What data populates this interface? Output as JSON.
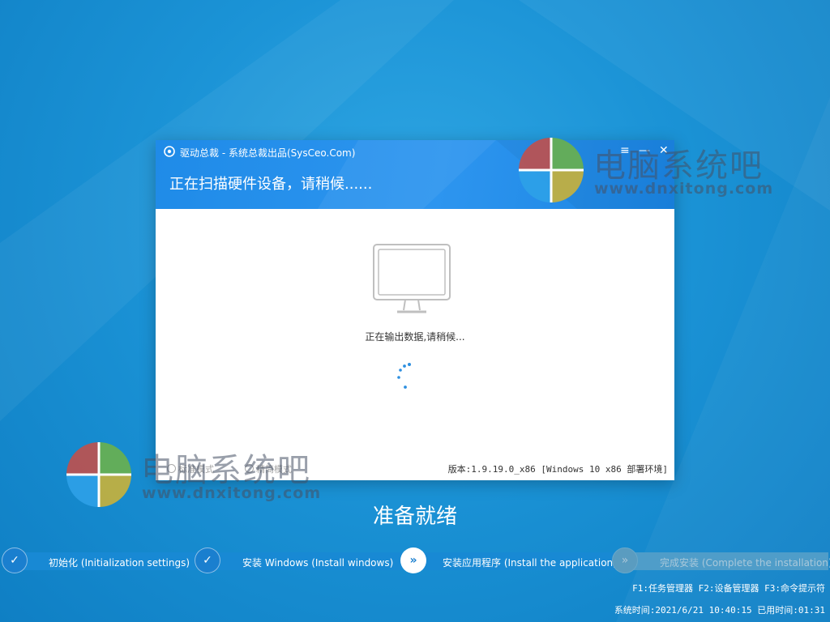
{
  "dialog": {
    "title": "驱动总裁 - 系统总裁出品(SysCeo.Com)",
    "heading": "正在扫描硬件设备，请稍候......",
    "menu_icon": "≡",
    "minimize_icon": "—",
    "close_icon": "✕",
    "status": "正在输出数据,请稍候...",
    "version": "版本:1.9.19.0_x86 [Windows 10 x86 部署环境]",
    "mode_options": [
      "标准模式",
      "精简模式"
    ]
  },
  "watermark": {
    "text": "电脑系统吧",
    "url": "www.dnxitong.com"
  },
  "ready_text": "准备就绪",
  "steps": [
    {
      "label": "初始化 (Initialization settings)",
      "icon": "✓",
      "state": "done"
    },
    {
      "label": "安装 Windows (Install windows)",
      "icon": "✓",
      "state": "done"
    },
    {
      "label": "安装应用程序 (Install the application)",
      "icon": "»",
      "state": "active"
    },
    {
      "label": "完成安装 (Complete the installation)",
      "icon": "»",
      "state": "pending"
    }
  ],
  "hotkeys": "F1:任务管理器 F2:设备管理器 F3:命令提示符",
  "system_time": "系统时间:2021/6/21 10:40:15 已用时间:01:31",
  "colors": {
    "background": "#1b93d6",
    "header": "#2d95ef",
    "logo_red": "#c0504d",
    "logo_green": "#6ab04c",
    "logo_blue": "#2ea1e8",
    "logo_yellow": "#c9b13a"
  }
}
